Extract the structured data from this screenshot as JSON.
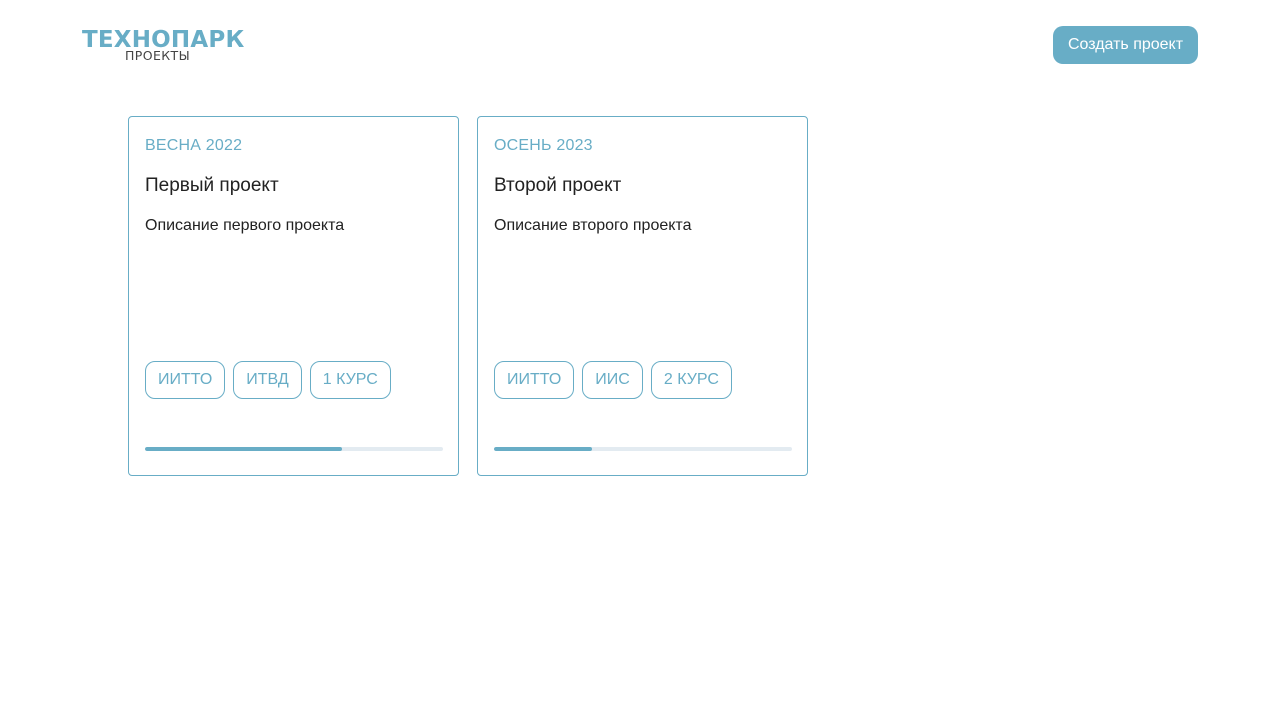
{
  "header": {
    "logo_main": "ТЕХНОПАРК",
    "logo_sub": "ПРОЕКТЫ",
    "create_button_label": "Создать проект"
  },
  "colors": {
    "accent": "#68adc6",
    "progress_track": "#e3ebf1",
    "text": "#222222"
  },
  "projects": [
    {
      "semester": "ВЕСНА 2022",
      "title": "Первый проект",
      "description": "Описание первого проекта",
      "tags": [
        "ИИТТО",
        "ИТВД",
        "1 КУРС"
      ],
      "progress": 0.66
    },
    {
      "semester": "ОСЕНЬ 2023",
      "title": "Второй проект",
      "description": "Описание второго проекта",
      "tags": [
        "ИИТТО",
        "ИИС",
        "2 КУРС"
      ],
      "progress": 0.33
    }
  ]
}
